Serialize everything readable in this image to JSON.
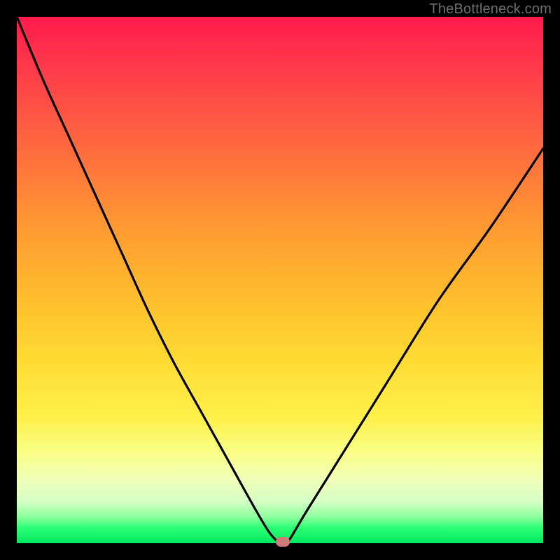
{
  "watermark": "TheBottleneck.com",
  "colors": {
    "frame": "#000000",
    "curve": "#000000",
    "dot": "#d17a78"
  },
  "chart_data": {
    "type": "line",
    "title": "",
    "xlabel": "",
    "ylabel": "",
    "xlim": [
      0,
      100
    ],
    "ylim": [
      0,
      100
    ],
    "grid": false,
    "legend": false,
    "series": [
      {
        "name": "bottleneck-curve",
        "x": [
          0,
          5,
          10,
          15,
          20,
          25,
          30,
          35,
          40,
          45,
          48,
          50,
          51,
          52,
          55,
          60,
          70,
          80,
          90,
          100
        ],
        "y": [
          100,
          88,
          77,
          66,
          55,
          44,
          34,
          25,
          16,
          7,
          2,
          0,
          0,
          1,
          6,
          14,
          30,
          46,
          60,
          75
        ]
      }
    ],
    "marker": {
      "x": 50.5,
      "y": 0
    },
    "background_gradient": {
      "stops": [
        {
          "pos": 0,
          "color": "#ff1a4d"
        },
        {
          "pos": 25,
          "color": "#ff6a3f"
        },
        {
          "pos": 52,
          "color": "#ffba2d"
        },
        {
          "pos": 76,
          "color": "#fff04a"
        },
        {
          "pos": 92,
          "color": "#d6ffc6"
        },
        {
          "pos": 100,
          "color": "#00e860"
        }
      ]
    }
  }
}
